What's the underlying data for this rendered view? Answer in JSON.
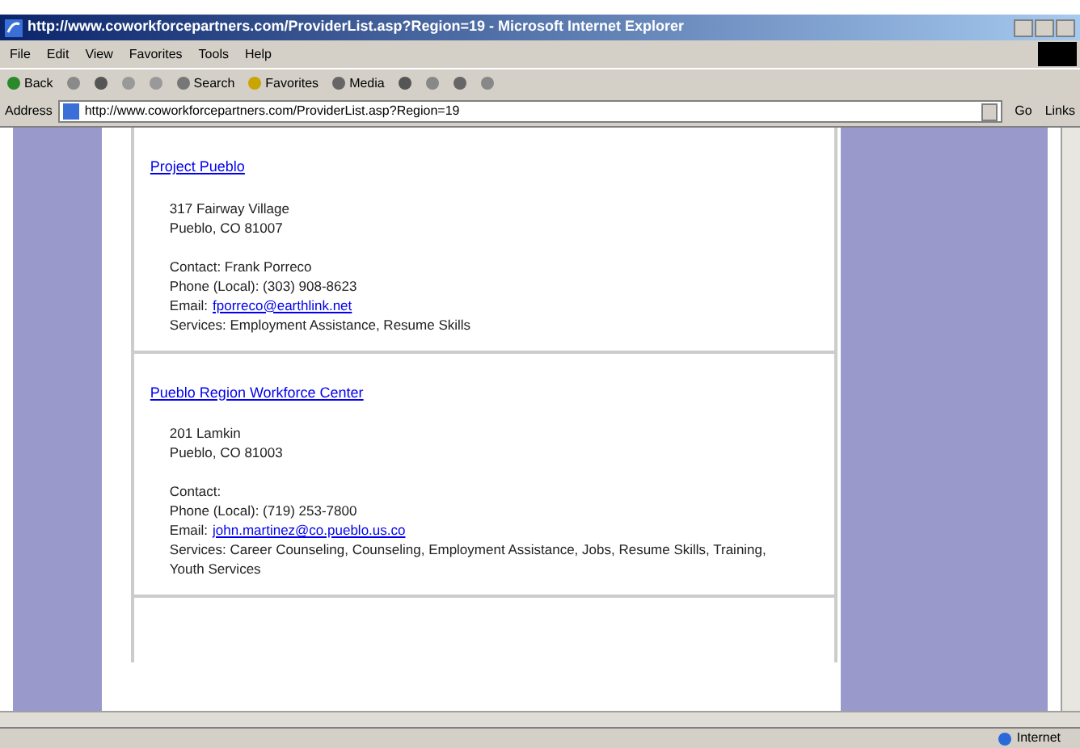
{
  "window": {
    "title": "http://www.coworkforcepartners.com/ProviderList.asp?Region=19 - Microsoft Internet Explorer"
  },
  "menu": [
    "File",
    "Edit",
    "View",
    "Favorites",
    "Tools",
    "Help"
  ],
  "toolbar": {
    "back": "Back",
    "search": "Search",
    "favorites": "Favorites",
    "media": "Media"
  },
  "address_bar": {
    "label": "Address",
    "value": "http://www.coworkforcepartners.com/ProviderList.asp?Region=19",
    "go": "Go",
    "links": "Links"
  },
  "providers": [
    {
      "name": "Project Pueblo",
      "address": [
        "317 Fairway Village",
        "Pueblo, CO 81007"
      ],
      "contact": "Contact: Frank Porreco",
      "phone": "Phone (Local): (303) 908-8623",
      "email_label": "Email:",
      "email": "fporreco@earthlink.net",
      "services": "Services: Employment Assistance, Resume Skills"
    },
    {
      "name": "Pueblo Region Workforce Center",
      "address": [
        "201 Lamkin",
        "Pueblo, CO 81003"
      ],
      "contact": "Contact:",
      "phone": "Phone (Local): (719) 253-7800",
      "email_label": "Email:",
      "email": "john.martinez@co.pueblo.us.co",
      "services": "Services: Career Counseling, Counseling, Employment Assistance, Jobs, Resume Skills, Training, Youth Services"
    }
  ],
  "status_bar": {
    "zone": "Internet"
  }
}
